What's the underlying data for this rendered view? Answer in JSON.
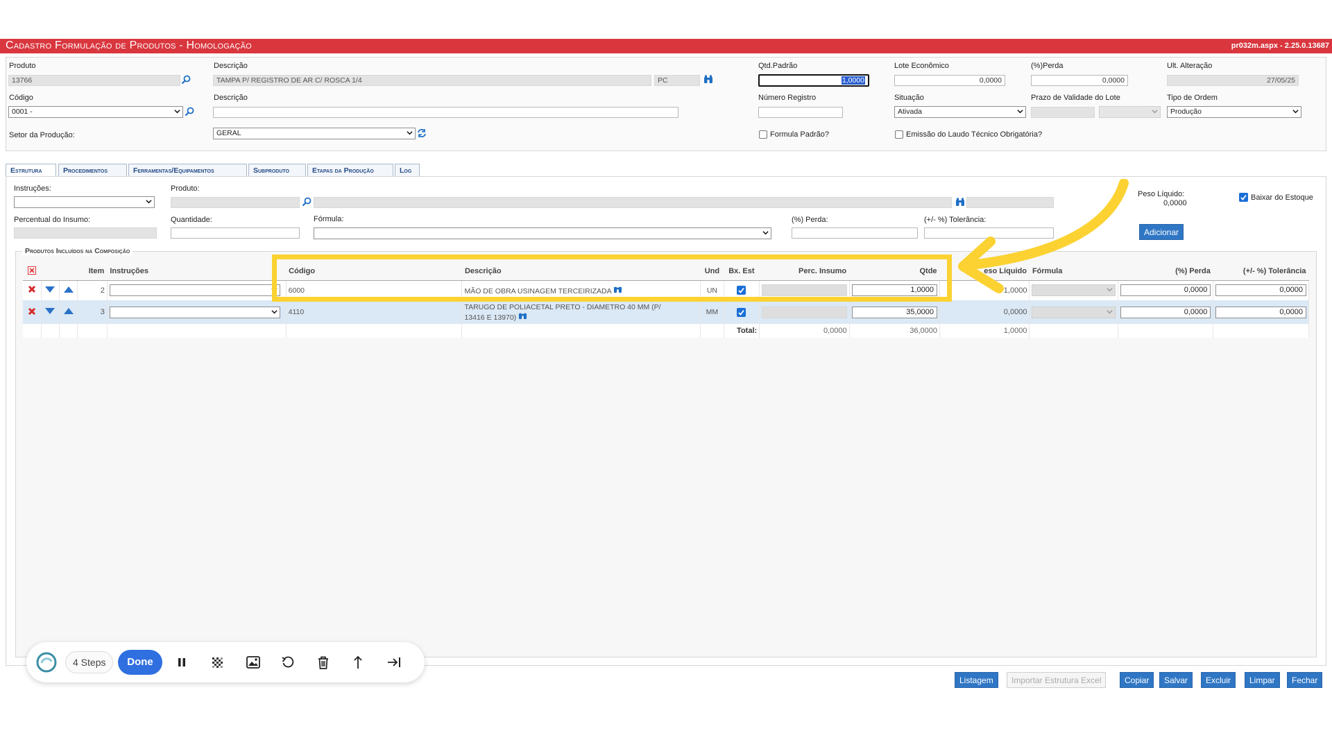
{
  "app": {
    "title": "Cadastro Formulação de Produtos  - Homologação",
    "version": "pr032m.aspx - 2.25.0.13687"
  },
  "header_form": {
    "produto_label": "Produto",
    "produto_value": "13766",
    "descricao_label": "Descrição",
    "descricao_value": "TAMPA P/ REGISTRO DE AR C/ ROSCA 1/4",
    "unidade_value": "PC",
    "qtd_padrao_label": "Qtd.Padrão",
    "qtd_padrao_value": "1,0000",
    "lote_economico_label": "Lote Econômico",
    "lote_economico_value": "0,0000",
    "perda_label": "(%)Perda",
    "perda_value": "0,0000",
    "ult_alteracao_label": "Ult. Alteração",
    "ult_alteracao_value": "27/05/25",
    "codigo_label": "Código",
    "codigo_value": "0001 -",
    "descricao2_label": "Descrição",
    "descricao2_value": "",
    "numero_registro_label": "Número Registro",
    "numero_registro_value": "",
    "situacao_label": "Situação",
    "situacao_value": "Ativada",
    "prazo_validade_label": "Prazo de Validade do Lote",
    "tipo_ordem_label": "Tipo de Ordem",
    "tipo_ordem_value": "Produção",
    "setor_label": "Setor da Produção:",
    "setor_value": "GERAL",
    "formula_padrao_label": "Formula Padrão?",
    "emissao_laudo_label": "Emissão do Laudo Técnico Obrigatória?"
  },
  "tabs": [
    {
      "label": "Estrutura"
    },
    {
      "label": "Procedimentos"
    },
    {
      "label": "Ferramentas/Equipamentos"
    },
    {
      "label": "Subproduto"
    },
    {
      "label": "Etapas da Produção"
    },
    {
      "label": "Log"
    }
  ],
  "estrutura_form": {
    "instrucoes_label": "Instruções:",
    "produto_label": "Produto:",
    "peso_liquido_label": "Peso Líquido:",
    "peso_liquido_value": "0,0000",
    "baixar_estoque_label": "Baixar do Estoque",
    "percentual_insumo_label": "Percentual do Insumo:",
    "quantidade_label": "Quantidade:",
    "formula_label": "Fórmula:",
    "perda_label": "(%) Perda:",
    "tolerancia_label": "(+/- %) Tolerância:",
    "adicionar_label": "Adicionar"
  },
  "grid": {
    "legend": "Produtos Incluídos na Composição",
    "headers": {
      "item": "Item",
      "instrucoes": "Instruções",
      "codigo": "Código",
      "descricao": "Descrição",
      "und": "Und",
      "bx_est": "Bx. Est",
      "perc_insumo": "Perc. Insumo",
      "qtde": "Qtde",
      "peso_liquido": "eso Líquido",
      "formula": "Fórmula",
      "perda": "(%) Perda",
      "tolerancia": "(+/- %) Tolerância"
    },
    "rows": [
      {
        "item": "2",
        "codigo": "6000",
        "descricao": "MÃO DE OBRA USINAGEM TERCEIRIZADA",
        "und": "UN",
        "qtde": "1,0000",
        "peso_liquido": "1,0000",
        "perda": "0,0000",
        "tolerancia": "0,0000"
      },
      {
        "item": "3",
        "codigo": "4110",
        "descricao_l1": "TARUGO DE POLIACETAL PRETO - DIAMETRO 40 MM (P/",
        "descricao_l2": "13416 E 13970)",
        "und": "MM",
        "qtde": "35,0000",
        "peso_liquido": "0,0000",
        "perda": "0,0000",
        "tolerancia": "0,0000"
      }
    ],
    "totals": {
      "label": "Total:",
      "perc_insumo": "0,0000",
      "qtde": "36,0000",
      "peso_liquido": "1,0000"
    }
  },
  "footer_buttons": {
    "listagem": "Listagem",
    "importar": "Importar Estrutura Excel",
    "copiar": "Copiar",
    "salvar": "Salvar",
    "excluir": "Excluir",
    "limpar": "Limpar",
    "fechar": "Fechar"
  },
  "recorder": {
    "steps": "4 Steps",
    "done": "Done"
  },
  "colors": {
    "titlebar": "#d9363e",
    "accent_blue": "#2f76c4",
    "highlight_yellow": "#fbd232",
    "row_selected": "#dbe8f5"
  }
}
